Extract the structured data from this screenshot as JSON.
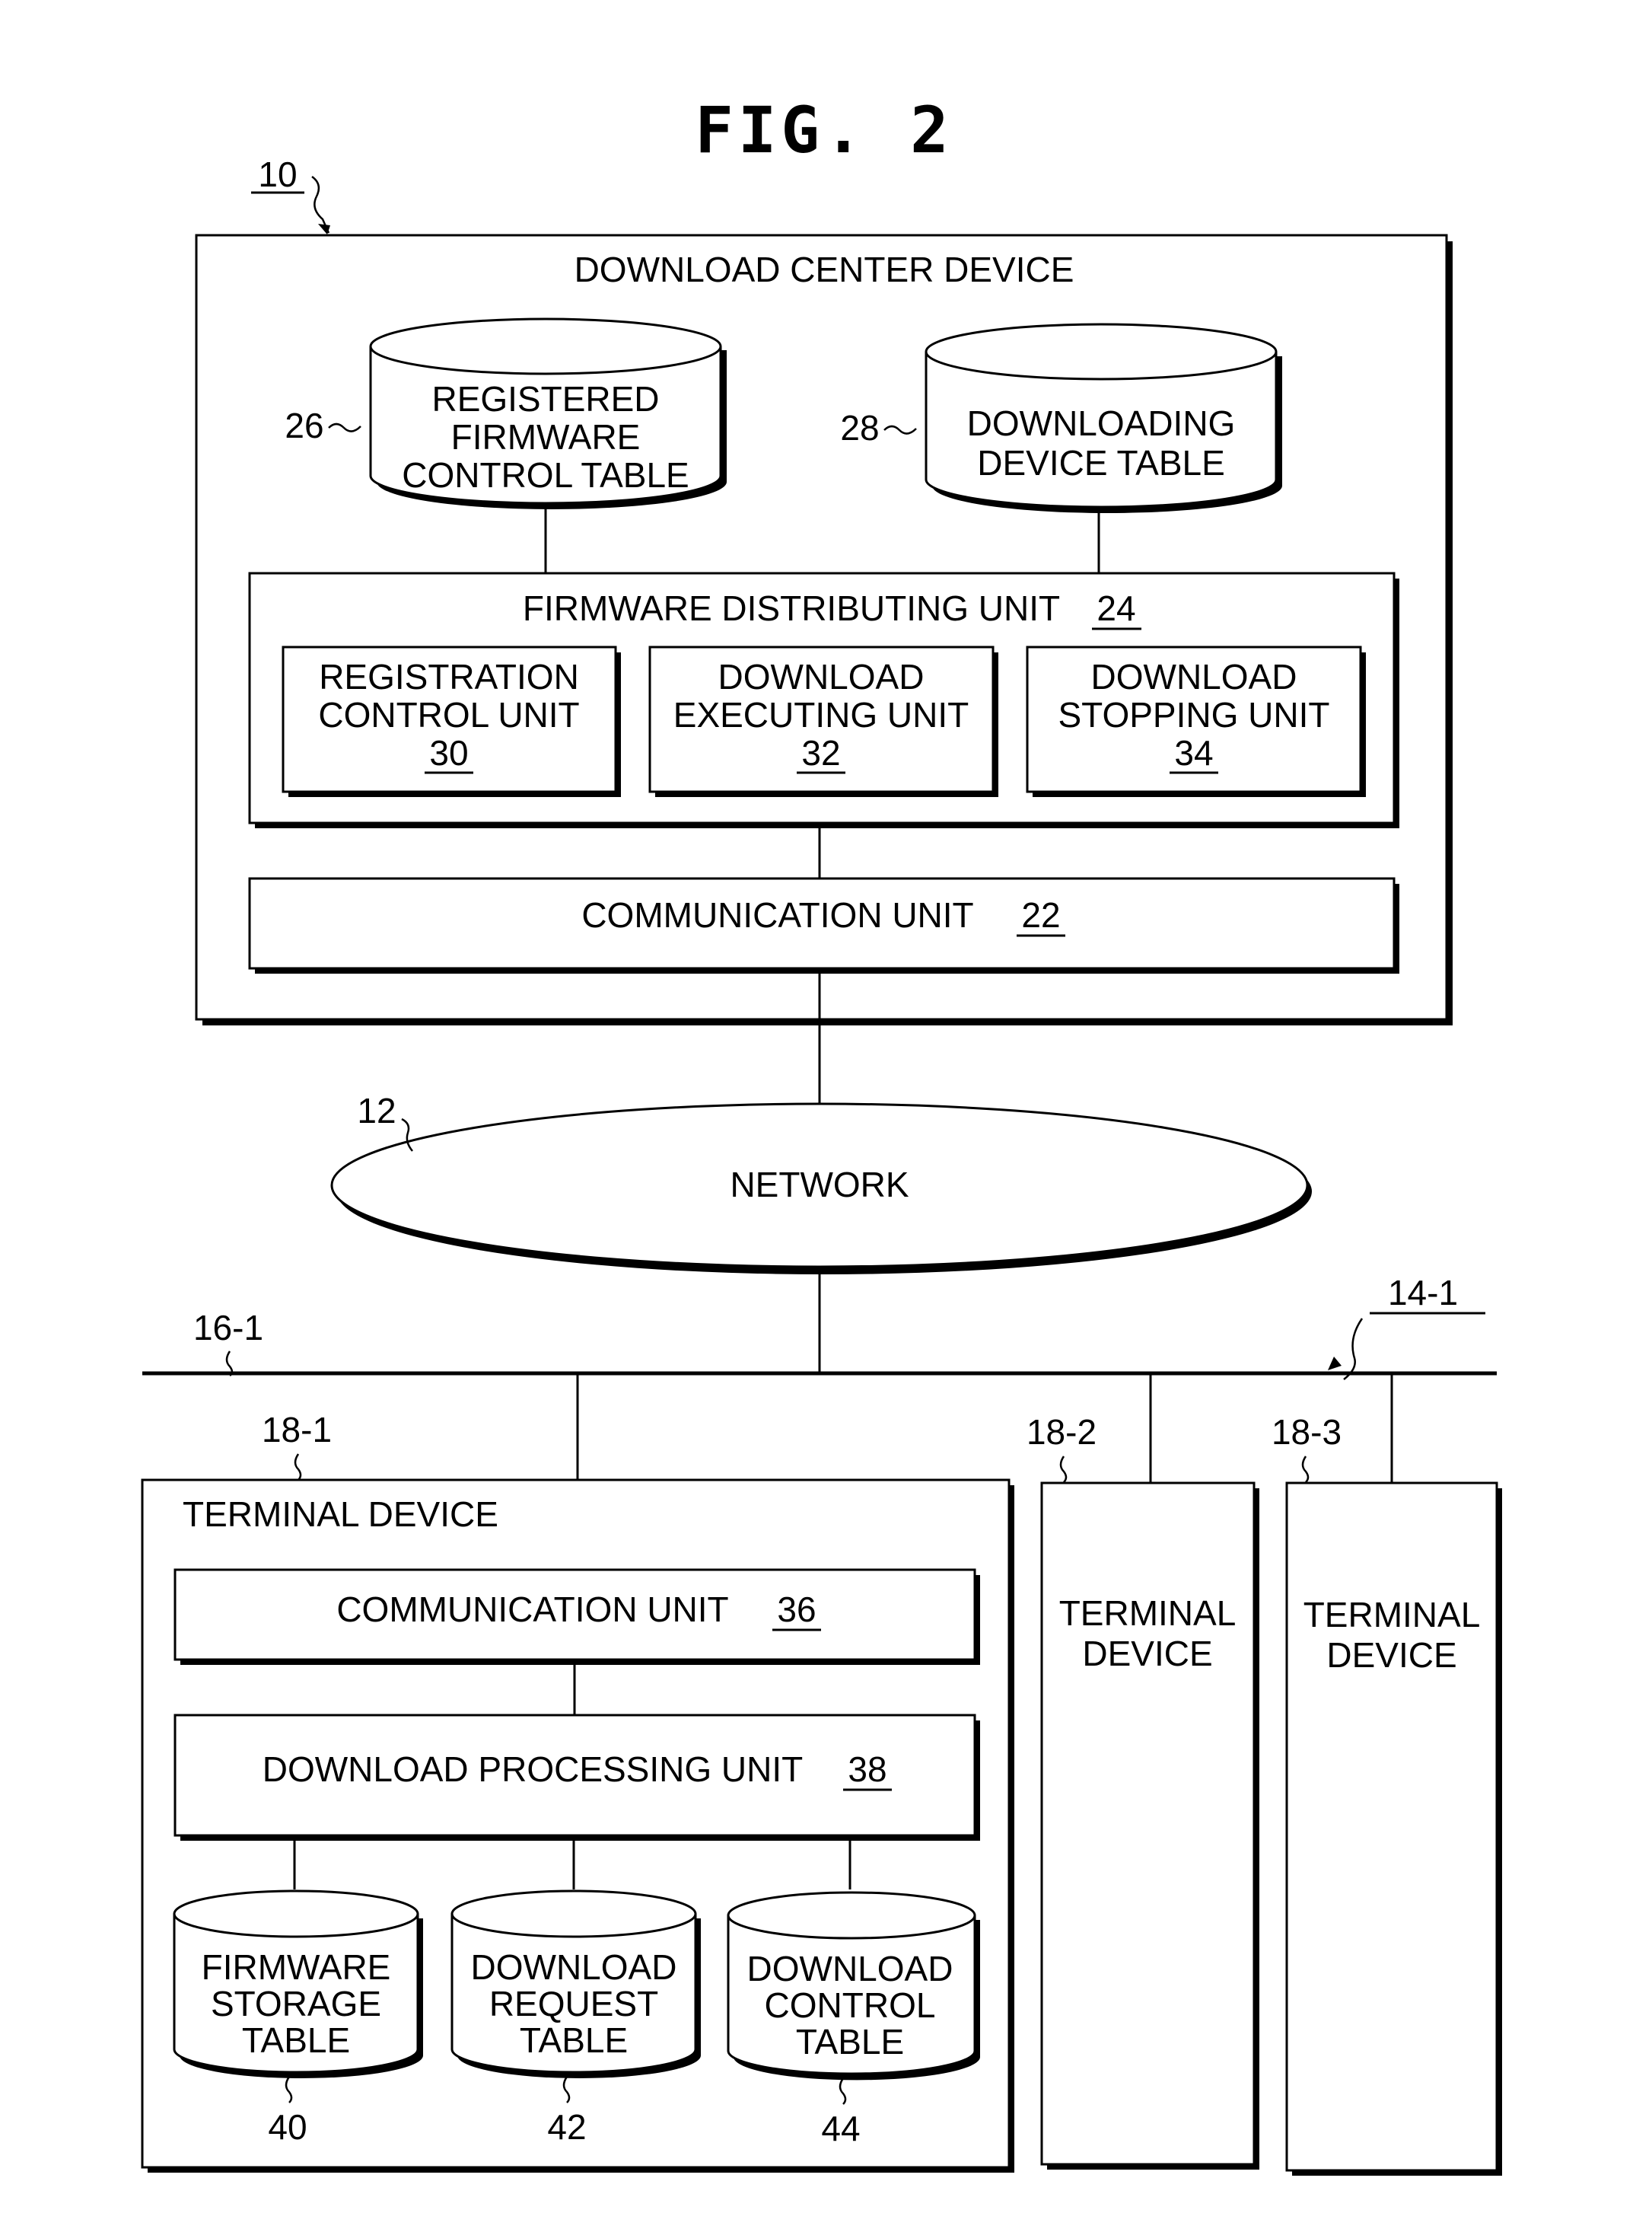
{
  "figure": {
    "title": "FIG. 2",
    "ref_system": "10",
    "center": {
      "label": "DOWNLOAD CENTER DEVICE",
      "db_registered": {
        "ref": "26",
        "lines": [
          "REGISTERED",
          "FIRMWARE",
          "CONTROL TABLE"
        ]
      },
      "db_downloading": {
        "ref": "28",
        "lines": [
          "DOWNLOADING",
          "DEVICE TABLE"
        ]
      },
      "distributing_unit": {
        "label": "FIRMWARE DISTRIBUTING UNIT",
        "ref": "24"
      },
      "registration_unit": {
        "lines": [
          "REGISTRATION",
          "CONTROL UNIT"
        ],
        "ref": "30"
      },
      "executing_unit": {
        "lines": [
          "DOWNLOAD",
          "EXECUTING UNIT"
        ],
        "ref": "32"
      },
      "stopping_unit": {
        "lines": [
          "DOWNLOAD",
          "STOPPING UNIT"
        ],
        "ref": "34"
      },
      "communication_unit": {
        "label": "COMMUNICATION UNIT",
        "ref": "22"
      }
    },
    "network": {
      "label": "NETWORK",
      "ref": "12"
    },
    "lan": {
      "ref_bus": "16-1",
      "ref_group": "14-1"
    },
    "terminal_1": {
      "ref": "18-1",
      "label": "TERMINAL DEVICE",
      "communication_unit": {
        "label": "COMMUNICATION UNIT",
        "ref": "36"
      },
      "processing_unit": {
        "label": "DOWNLOAD PROCESSING UNIT",
        "ref": "38"
      },
      "db_firmware_storage": {
        "ref": "40",
        "lines": [
          "FIRMWARE",
          "STORAGE",
          "TABLE"
        ]
      },
      "db_download_request": {
        "ref": "42",
        "lines": [
          "DOWNLOAD",
          "REQUEST",
          "TABLE"
        ]
      },
      "db_download_control": {
        "ref": "44",
        "lines": [
          "DOWNLOAD",
          "CONTROL",
          "TABLE"
        ]
      }
    },
    "terminal_2": {
      "ref": "18-2",
      "lines": [
        "TERMINAL",
        "DEVICE"
      ]
    },
    "terminal_3": {
      "ref": "18-3",
      "lines": [
        "TERMINAL",
        "DEVICE"
      ]
    }
  }
}
